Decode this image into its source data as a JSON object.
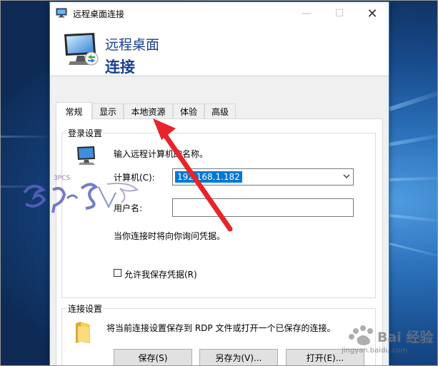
{
  "window": {
    "title": "远程桌面连接",
    "minimize_glyph": "—",
    "maximize_glyph": "☐",
    "close_glyph": "✕"
  },
  "banner": {
    "line1": "远程桌面",
    "line2": "连接"
  },
  "tabs": [
    {
      "label": "常规",
      "active": true
    },
    {
      "label": "显示",
      "active": false
    },
    {
      "label": "本地资源",
      "active": false
    },
    {
      "label": "体验",
      "active": false
    },
    {
      "label": "高级",
      "active": false
    }
  ],
  "login_settings": {
    "group_title": "登录设置",
    "instruction": "输入远程计算机的名称。",
    "computer_label": "计算机(C):",
    "computer_value": "192.168.1.182",
    "username_label": "用户名:",
    "username_value": "",
    "credentials_note": "当你连接时将向你询问凭据。",
    "save_credentials_label": "允许我保存凭据(R)",
    "save_credentials_checked": false
  },
  "connection_settings": {
    "group_title": "连接设置",
    "description": "将当前连接设置保存到 RDP 文件或打开一个已保存的连接。",
    "save_button": "保存(S)",
    "save_as_button": "另存为(V)...",
    "open_button": "打开(E)..."
  },
  "watermarks": {
    "logo_text": "3PCS",
    "baidu_text": "Bai 经验",
    "baidu_url": "jingyan.baidu.com"
  },
  "colors": {
    "accent": "#0078d7",
    "banner_text": "#1a3f8f",
    "annotation_arrow": "#e8242a"
  },
  "icons": {
    "title_icon": "remote-desktop-icon",
    "banner_icon": "remote-desktop-monitor-icon",
    "login_icon": "computer-monitor-icon",
    "connection_icon": "folder-icon"
  }
}
